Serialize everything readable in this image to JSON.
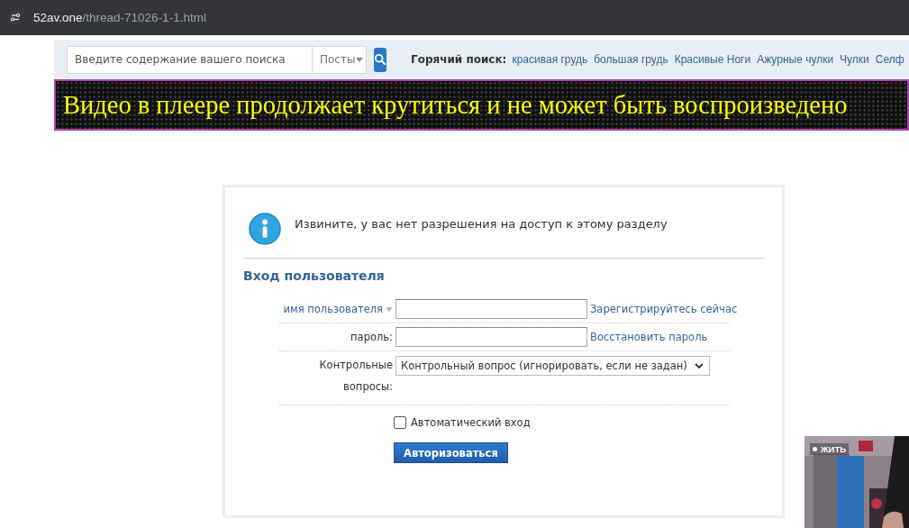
{
  "address_bar": {
    "host": "52av.one",
    "path": "/thread-71026-1-1.html"
  },
  "search": {
    "placeholder": "Введите содержание вашего поиска",
    "scope": "Посты"
  },
  "hot_search": {
    "label": "Горячий поиск:",
    "links": [
      "красивая грудь",
      "большая грудь",
      "Красивые Ноги",
      "Ажурные чулки",
      "Чулки",
      "Селф"
    ]
  },
  "banner": {
    "text": "Видео в плеере продолжает крутиться и не может быть воспроизведено"
  },
  "notice": "Извините, у вас нет разрешения на доступ к этому разделу",
  "login": {
    "title": "Вход пользователя",
    "rows": [
      {
        "kind": "input",
        "label": "имя пользователя",
        "label_dropdown": true,
        "link": "Зарегистрируйтесь сейчас"
      },
      {
        "kind": "input",
        "label": "пароль:",
        "label_dropdown": false,
        "link": "Восстановить пароль"
      },
      {
        "kind": "select",
        "label": "Контрольные вопросы:",
        "value": "Контрольный вопрос (игнорировать, если не задан)"
      }
    ],
    "auto_login": {
      "label": "Автоматический вход",
      "checked": false
    },
    "button": "Авторизоваться"
  },
  "live_video": {
    "badge": "ЖИТЬ"
  }
}
